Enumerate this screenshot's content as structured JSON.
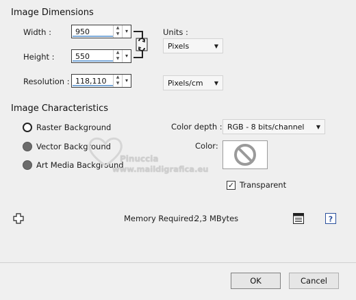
{
  "image_dimensions": {
    "title": "Image Dimensions",
    "width_label": "Width :",
    "width_value": "950",
    "height_label": "Height :",
    "height_value": "550",
    "resolution_label": "Resolution :",
    "resolution_value": "118,110",
    "units_label": "Units :",
    "units_value": "Pixels",
    "resolution_units_value": "Pixels/cm"
  },
  "image_characteristics": {
    "title": "Image Characteristics",
    "radio_raster": "Raster Background",
    "radio_vector": "Vector Background",
    "radio_art_media": "Art Media Background",
    "selected": "raster",
    "color_depth_label": "Color depth :",
    "color_depth_value": "RGB - 8 bits/channel",
    "color_label": "Color:",
    "transparent_label": "Transparent",
    "transparent_checked": true
  },
  "watermark": {
    "line1": "Pinuccia",
    "line2": "www.maildigrafica.eu"
  },
  "memory": {
    "label": "Memory Required:",
    "value": "2,3 MBytes"
  },
  "buttons": {
    "ok": "OK",
    "cancel": "Cancel"
  },
  "icons": {
    "lock": "chain-link-icon",
    "crosshair": "move-cross-icon",
    "presets": "preset-list-icon",
    "help": "help-icon",
    "no_color": "no-color-icon"
  }
}
